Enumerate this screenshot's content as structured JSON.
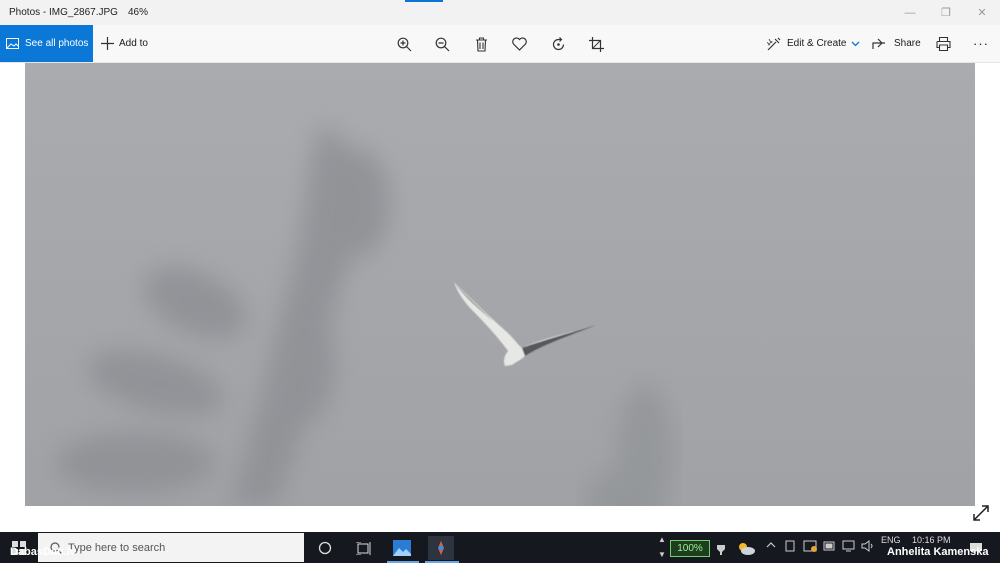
{
  "window": {
    "title": "Photos - IMG_2867.JPG",
    "zoom": "46%",
    "controls": {
      "minimize": "—",
      "maximize": "❐",
      "close": "✕"
    }
  },
  "toolbar": {
    "see_all": "See all photos",
    "add_to": "Add to",
    "edit_create": "Edit & Create",
    "share": "Share",
    "more": "···"
  },
  "icons": [
    "zoom-in-icon",
    "zoom-out-icon",
    "delete-icon",
    "favorite-icon",
    "rotate-icon",
    "crop-icon",
    "print-icon",
    "expand-icon"
  ],
  "taskbar": {
    "search_placeholder": "Type here to search",
    "zoom_badge": "100%",
    "language": "ENG",
    "time": "10:16 PM",
    "watermark_left": "DabasDati.lv",
    "watermark_right": "Anhelita Kamenska"
  },
  "colors": {
    "accent": "#0b78d7",
    "taskbar": "#15191f",
    "sky": "#a4a6aa"
  }
}
